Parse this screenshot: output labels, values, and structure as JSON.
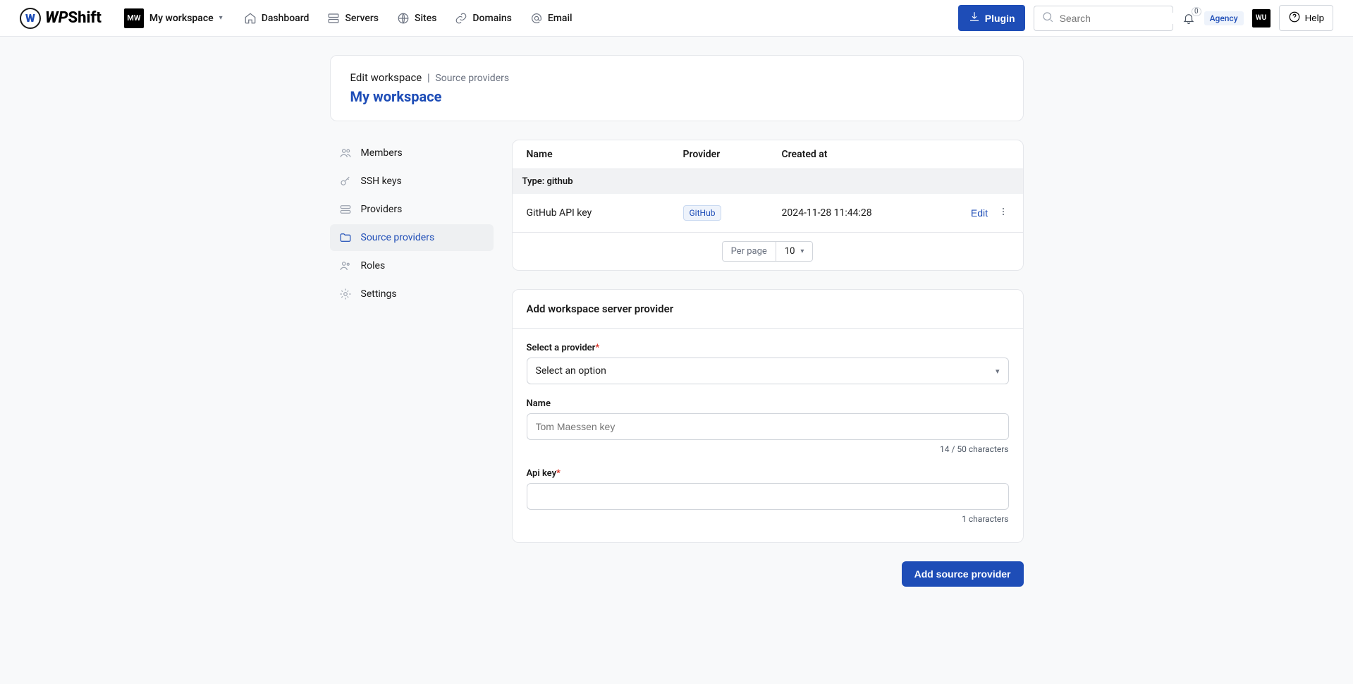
{
  "brand": {
    "wp": "WP",
    "shift": "Shift",
    "logo_letter": "W"
  },
  "topbar": {
    "workspace_badge": "MW",
    "workspace_name": "My workspace",
    "nav": {
      "dashboard": "Dashboard",
      "servers": "Servers",
      "sites": "Sites",
      "domains": "Domains",
      "email": "Email"
    },
    "plugin_label": "Plugin",
    "search_placeholder": "Search",
    "bell_count": "0",
    "agency_label": "Agency",
    "user_badge": "WU",
    "help_label": "Help"
  },
  "header": {
    "breadcrumb_main": "Edit workspace",
    "breadcrumb_sep": "|",
    "breadcrumb_sub": "Source providers",
    "title": "My workspace"
  },
  "sidebar": {
    "members": "Members",
    "ssh": "SSH keys",
    "providers": "Providers",
    "source": "Source providers",
    "roles": "Roles",
    "settings": "Settings"
  },
  "table": {
    "columns": {
      "name": "Name",
      "provider": "Provider",
      "created": "Created at"
    },
    "group_label": "Type: github",
    "rows": [
      {
        "name": "GitHub API key",
        "provider": "GitHub",
        "created": "2024-11-28 11:44:28",
        "edit": "Edit"
      }
    ],
    "per_page_label": "Per page",
    "per_page_value": "10"
  },
  "form": {
    "title": "Add workspace server provider",
    "provider_label": "Select a provider",
    "provider_placeholder": "Select an option",
    "name_label": "Name",
    "name_placeholder": "Tom Maessen key",
    "name_helper": "14 / 50 characters",
    "api_label": "Api key",
    "api_helper": "1 characters",
    "submit": "Add source provider"
  }
}
